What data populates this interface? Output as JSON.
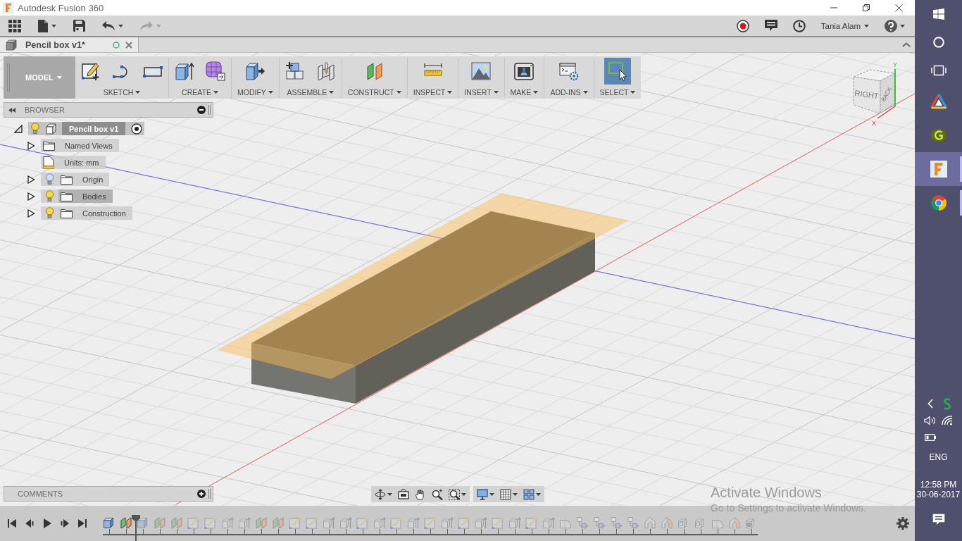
{
  "window": {
    "title": "Autodesk Fusion 360"
  },
  "quick_access": {
    "tools": [
      {
        "kind": "apps",
        "dropdown": false,
        "disabled": false
      },
      {
        "kind": "file",
        "dropdown": true,
        "disabled": false
      },
      {
        "kind": "save",
        "dropdown": false,
        "disabled": false
      },
      {
        "kind": "undo",
        "dropdown": true,
        "disabled": false
      },
      {
        "kind": "redo",
        "dropdown": true,
        "disabled": true
      }
    ],
    "status": [
      {
        "kind": "record"
      },
      {
        "kind": "comments"
      },
      {
        "kind": "history"
      }
    ],
    "user": "Tania Alam"
  },
  "tabs": [
    {
      "title": "Pencil box v1*",
      "selected": true
    }
  ],
  "toolbar": {
    "workspace": "MODEL",
    "groups": [
      {
        "label": "SKETCH",
        "tools": [
          {
            "kind": "sketch",
            "selected": false
          },
          {
            "kind": "arc",
            "selected": false
          },
          {
            "kind": "rectangle",
            "selected": false
          }
        ]
      },
      {
        "label": "CREATE",
        "tools": [
          {
            "kind": "extrude",
            "selected": false
          },
          {
            "kind": "form",
            "selected": false
          }
        ]
      },
      {
        "label": "MODIFY",
        "tools": [
          {
            "kind": "press_pull",
            "selected": false
          }
        ]
      },
      {
        "label": "ASSEMBLE",
        "tools": [
          {
            "kind": "component",
            "selected": false
          },
          {
            "kind": "joint",
            "selected": false
          }
        ]
      },
      {
        "label": "CONSTRUCT",
        "tools": [
          {
            "kind": "plane",
            "selected": false
          }
        ]
      },
      {
        "label": "INSPECT",
        "tools": [
          {
            "kind": "measure",
            "selected": false
          }
        ]
      },
      {
        "label": "INSERT",
        "tools": [
          {
            "kind": "image",
            "selected": false
          }
        ]
      },
      {
        "label": "MAKE",
        "tools": [
          {
            "kind": "print",
            "selected": false
          }
        ]
      },
      {
        "label": "ADD-INS",
        "tools": [
          {
            "kind": "scripts",
            "selected": false
          }
        ]
      },
      {
        "label": "SELECT",
        "tools": [
          {
            "kind": "select",
            "selected": true
          }
        ]
      }
    ]
  },
  "browser": {
    "title": "BROWSER",
    "root": {
      "label": "Pencil box v1",
      "expanded": true,
      "visible": true,
      "children": [
        {
          "kind": "folder",
          "label": "Named Views",
          "expanded": false,
          "selected": false
        },
        {
          "kind": "units",
          "label": "Units: mm",
          "selected": false
        },
        {
          "kind": "folder",
          "label": "Origin",
          "expanded": false,
          "visible": false,
          "selected": false
        },
        {
          "kind": "folder",
          "label": "Bodies",
          "expanded": false,
          "visible": true,
          "selected": true
        },
        {
          "kind": "folder",
          "label": "Construction",
          "expanded": false,
          "visible": true,
          "selected": false
        }
      ]
    }
  },
  "comments": {
    "title": "COMMENTS"
  },
  "view_cube": {
    "faces": [
      "RIGHT",
      "BACK"
    ],
    "axes": [
      "Y",
      "X"
    ]
  },
  "nav_bar": [
    {
      "tools": [
        {
          "kind": "orbit",
          "dropdown": true
        },
        {
          "kind": "look_at",
          "dropdown": false
        },
        {
          "kind": "pan",
          "dropdown": false
        },
        {
          "kind": "zoom",
          "dropdown": false
        },
        {
          "kind": "fit",
          "dropdown": true
        }
      ]
    },
    {
      "tools": [
        {
          "kind": "display",
          "dropdown": true
        },
        {
          "kind": "grid",
          "dropdown": true
        },
        {
          "kind": "viewports",
          "dropdown": true
        }
      ]
    }
  ],
  "timeline": {
    "features": [
      {
        "kind": "box",
        "active": true
      },
      {
        "kind": "plane",
        "active": true
      },
      {
        "kind": "box",
        "active": false
      },
      {
        "kind": "plane",
        "active": false
      },
      {
        "kind": "plane",
        "active": false
      },
      {
        "kind": "sketch",
        "active": false
      },
      {
        "kind": "sketch",
        "active": false
      },
      {
        "kind": "extrude",
        "active": false
      },
      {
        "kind": "extrude",
        "active": false
      },
      {
        "kind": "plane",
        "active": false
      },
      {
        "kind": "plane",
        "active": false
      },
      {
        "kind": "sketch",
        "active": false
      },
      {
        "kind": "sketch",
        "active": false
      },
      {
        "kind": "extrude",
        "active": false
      },
      {
        "kind": "extrude",
        "active": false
      },
      {
        "kind": "sketch",
        "active": false
      },
      {
        "kind": "extrude",
        "active": false
      },
      {
        "kind": "sketch",
        "active": false
      },
      {
        "kind": "extrude",
        "active": false
      },
      {
        "kind": "sketch",
        "active": false
      },
      {
        "kind": "extrude",
        "active": false
      },
      {
        "kind": "sketch",
        "active": false
      },
      {
        "kind": "extrude",
        "active": false
      },
      {
        "kind": "sketch",
        "active": false
      },
      {
        "kind": "extrude",
        "active": false
      },
      {
        "kind": "sketch",
        "active": false
      },
      {
        "kind": "extrude",
        "active": false
      },
      {
        "kind": "fillet",
        "active": false
      },
      {
        "kind": "move",
        "active": false
      },
      {
        "kind": "move",
        "active": false
      },
      {
        "kind": "move",
        "active": false
      },
      {
        "kind": "move",
        "active": false
      },
      {
        "kind": "shell",
        "active": false
      },
      {
        "kind": "thicken",
        "active": false
      },
      {
        "kind": "hole",
        "active": false
      },
      {
        "kind": "hole",
        "active": false
      },
      {
        "kind": "fillet",
        "active": false
      },
      {
        "kind": "thicken",
        "active": false
      },
      {
        "kind": "combine",
        "active": false
      }
    ]
  },
  "activation_notice": {
    "title": "Activate Windows",
    "text": "Go to Settings to activate Windows."
  },
  "taskbar": {
    "apps": [
      {
        "kind": "autodesk",
        "selected": false,
        "running": false
      },
      {
        "kind": "g_app",
        "selected": false,
        "running": false
      },
      {
        "kind": "fusion",
        "selected": true,
        "running": true
      },
      {
        "kind": "chrome",
        "selected": false,
        "running": true
      }
    ],
    "language": "ENG",
    "time": "12:58 PM",
    "date": "30-06-2017"
  }
}
